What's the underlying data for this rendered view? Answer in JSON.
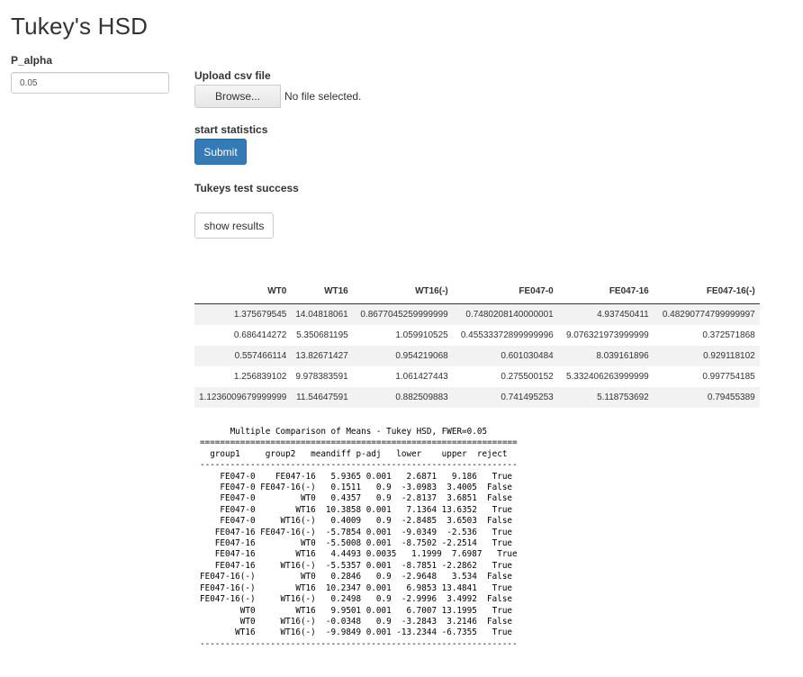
{
  "app_title": "Tukey's HSD",
  "p_alpha": {
    "label": "P_alpha",
    "value": "0.05"
  },
  "upload": {
    "label": "Upload csv file",
    "browse_label": "Browse...",
    "status": "No file selected."
  },
  "stats": {
    "label": "start statistics",
    "submit_label": "Submit"
  },
  "status_text": "Tukeys test success",
  "show_results_label": "show results",
  "colors": {
    "primary": "#337ab7",
    "stripe": "#f2f2f2"
  },
  "results_table": {
    "columns": [
      "WT0",
      "WT16",
      "WT16(-)",
      "FE047-0",
      "FE047-16",
      "FE047-16(-)"
    ],
    "rows": [
      [
        "1.375679545",
        "14.04818061",
        "0.8677045259999999",
        "0.7480208140000001",
        "4.937450411",
        "0.48290774799999997"
      ],
      [
        "0.686414272",
        "5.350681195",
        "1.059910525",
        "0.45533372899999996",
        "9.076321973999999",
        "0.372571868"
      ],
      [
        "0.557466114",
        "13.82671427",
        "0.954219068",
        "0.601030484",
        "8.039161896",
        "0.929118102"
      ],
      [
        "1.256839102",
        "9.978383591",
        "1.061427443",
        "0.275500152",
        "5.332406263999999",
        "0.997754185"
      ],
      [
        "1.1236009679999999",
        "11.54647591",
        "0.882509883",
        "0.741495253",
        "5.118753692",
        "0.79455389"
      ]
    ]
  },
  "tukey_summary": "      Multiple Comparison of Means - Tukey HSD, FWER=0.05      \n===============================================================\n  group1     group2   meandiff p-adj   lower    upper  reject\n---------------------------------------------------------------\n    FE047-0    FE047-16   5.9365 0.001   2.6871   9.186   True\n    FE047-0 FE047-16(-)   0.1511   0.9  -3.0983  3.4005  False\n    FE047-0         WT0   0.4357   0.9  -2.8137  3.6851  False\n    FE047-0        WT16  10.3858 0.001   7.1364 13.6352   True\n    FE047-0     WT16(-)   0.4009   0.9  -2.8485  3.6503  False\n   FE047-16 FE047-16(-)  -5.7854 0.001  -9.0349  -2.536   True\n   FE047-16         WT0  -5.5008 0.001  -8.7502 -2.2514   True\n   FE047-16        WT16   4.4493 0.0035   1.1999  7.6987   True\n   FE047-16     WT16(-)  -5.5357 0.001  -8.7851 -2.2862   True\nFE047-16(-)         WT0   0.2846   0.9  -2.9648   3.534  False\nFE047-16(-)        WT16  10.2347 0.001   6.9853 13.4841   True\nFE047-16(-)     WT16(-)   0.2498   0.9  -2.9996  3.4992  False\n        WT0        WT16   9.9501 0.001   6.7007 13.1995   True\n        WT0     WT16(-)  -0.0348   0.9  -3.2843  3.2146  False\n       WT16     WT16(-)  -9.9849 0.001 -13.2344 -6.7355   True\n---------------------------------------------------------------"
}
